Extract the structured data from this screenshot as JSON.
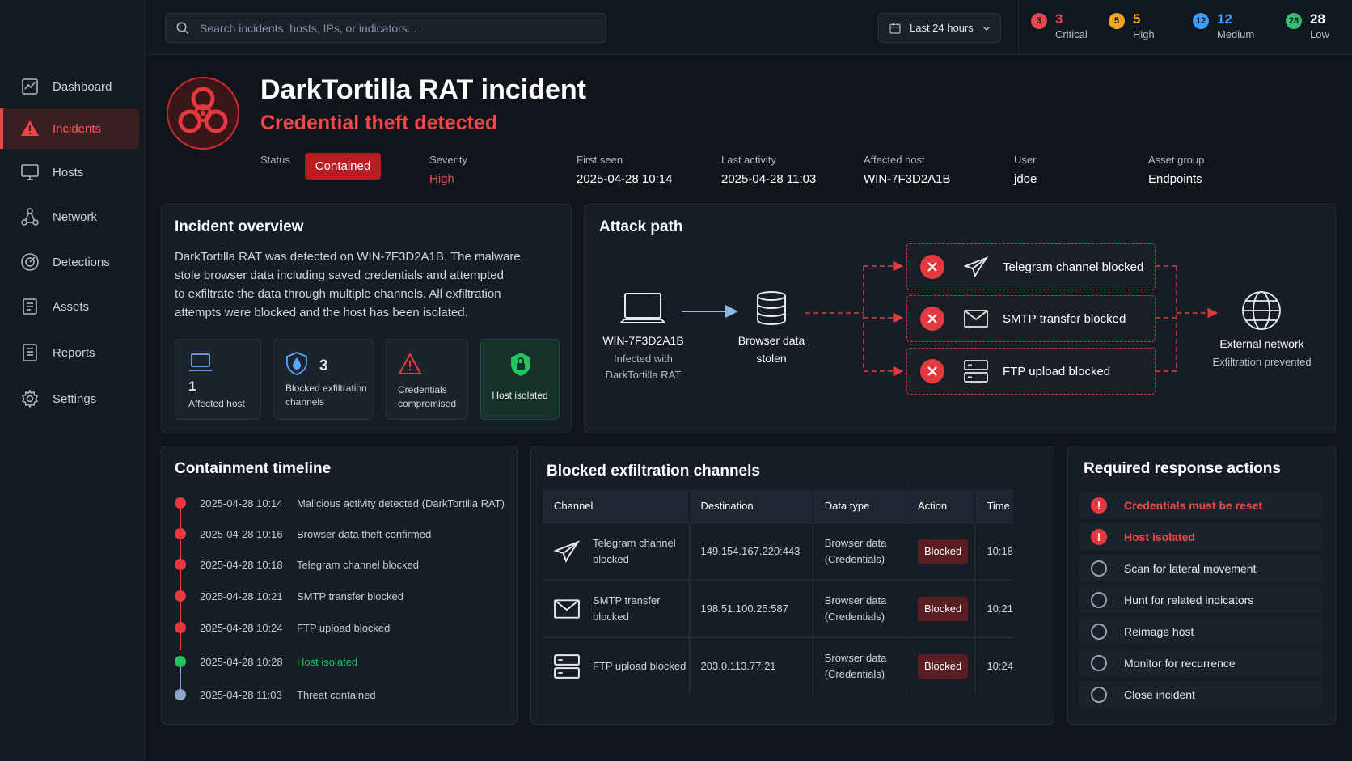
{
  "search": {
    "placeholder": "Search incidents, hosts, IPs, or indicators..."
  },
  "time_range": {
    "label": "Last 24 hours"
  },
  "severity_counts": [
    {
      "count": "3",
      "label": "Critical",
      "color": "#e5484d"
    },
    {
      "count": "5",
      "label": "High",
      "color": "#f5a524"
    },
    {
      "count": "12",
      "label": "Medium",
      "color": "#3b9eff"
    },
    {
      "count": "28",
      "label": "Low",
      "color": "#2fbf71"
    }
  ],
  "sidebar": {
    "items": [
      {
        "label": "Dashboard",
        "icon": "dashboard-icon"
      },
      {
        "label": "Incidents",
        "icon": "warning-icon"
      },
      {
        "label": "Hosts",
        "icon": "monitor-icon"
      },
      {
        "label": "Network",
        "icon": "network-icon"
      },
      {
        "label": "Detections",
        "icon": "radar-icon"
      },
      {
        "label": "Assets",
        "icon": "asset-icon"
      },
      {
        "label": "Reports",
        "icon": "report-icon"
      },
      {
        "label": "Settings",
        "icon": "gear-icon"
      }
    ]
  },
  "incident": {
    "title": "DarkTortilla RAT incident",
    "subtitle": "Credential theft detected",
    "status_label": "Status",
    "status_value": "Contained",
    "severity_label": "Severity",
    "severity_value": "High",
    "first_seen_label": "First seen",
    "first_seen_value": "2025-04-28 10:14",
    "last_activity_label": "Last activity",
    "last_activity_value": "2025-04-28 11:03",
    "affected_host_label": "Affected host",
    "affected_host_value": "WIN-7F3D2A1B",
    "user_label": "User",
    "user_value": "jdoe",
    "asset_group_label": "Asset group",
    "asset_group_value": "Endpoints"
  },
  "overview": {
    "title": "Incident overview",
    "lines": [
      "DarkTortilla RAT was detected on WIN-7F3D2A1B. The malware",
      "stole browser data including saved credentials and attempted",
      "to exfiltrate the data through multiple channels. All exfiltration",
      "attempts were blocked and the host has been isolated."
    ],
    "cards": [
      {
        "value": "1",
        "label": "Affected host",
        "icon": "laptop-icon"
      },
      {
        "value": "3",
        "label_line1": "Blocked exfiltration",
        "label_line2": "channels",
        "icon": "shield-drop-icon"
      },
      {
        "label_line1": "Credentials",
        "label_line2": "compromised",
        "icon": "alert-triangle-icon"
      },
      {
        "label": "Host isolated",
        "icon": "lock-shield-icon"
      }
    ]
  },
  "attack_path": {
    "title": "Attack path",
    "host_name": "WIN-7F3D2A1B",
    "host_sub1": "Infected with",
    "host_sub2": "DarkTortilla RAT",
    "data_label1": "Browser data",
    "data_label2": "stolen",
    "blocked": [
      {
        "label": "Telegram channel blocked",
        "icon": "paper-plane-icon"
      },
      {
        "label": "SMTP transfer blocked",
        "icon": "envelope-icon"
      },
      {
        "label": "FTP upload blocked",
        "icon": "server-icon"
      }
    ],
    "target_label": "External network",
    "target_sub": "Exfiltration prevented"
  },
  "timeline": {
    "title": "Containment timeline",
    "events": [
      {
        "time": "2025-04-28 10:14",
        "desc": "Malicious activity detected (DarkTortilla RAT)",
        "color": "#e53940"
      },
      {
        "time": "2025-04-28 10:16",
        "desc": "Browser data theft confirmed",
        "color": "#e53940"
      },
      {
        "time": "2025-04-28 10:18",
        "desc": "Telegram channel blocked",
        "color": "#e53940"
      },
      {
        "time": "2025-04-28 10:21",
        "desc": "SMTP transfer blocked",
        "color": "#e53940"
      },
      {
        "time": "2025-04-28 10:24",
        "desc": "FTP upload blocked",
        "color": "#e53940"
      },
      {
        "time": "2025-04-28 10:28",
        "desc": "Host isolated",
        "color": "#22c55e"
      },
      {
        "time": "2025-04-28 11:03",
        "desc": "Threat contained",
        "color": "#8fa3c4"
      }
    ]
  },
  "channels": {
    "title": "Blocked exfiltration channels",
    "headers": [
      "Channel",
      "Destination",
      "Data type",
      "Action",
      "Time"
    ],
    "rows": [
      {
        "channel1": "Telegram channel",
        "channel2": "blocked",
        "icon": "paper-plane-icon",
        "destination": "149.154.167.220:443",
        "type1": "Browser data",
        "type2": "(Credentials)",
        "action": "Blocked",
        "time": "10:18"
      },
      {
        "channel1": "SMTP transfer",
        "channel2": "blocked",
        "icon": "envelope-icon",
        "destination": "198.51.100.25:587",
        "type1": "Browser data",
        "type2": "(Credentials)",
        "action": "Blocked",
        "time": "10:21"
      },
      {
        "channel1": "FTP upload blocked",
        "channel2": "",
        "icon": "server-icon",
        "destination": "203.0.113.77:21",
        "type1": "Browser data",
        "type2": "(Credentials)",
        "action": "Blocked",
        "time": "10:24"
      }
    ]
  },
  "actions": {
    "title": "Required response actions",
    "items": [
      {
        "label": "Credentials must be reset",
        "urgent": true
      },
      {
        "label": "Host isolated",
        "urgent": true
      },
      {
        "label": "Scan for lateral movement",
        "urgent": false
      },
      {
        "label": "Hunt for related indicators",
        "urgent": false
      },
      {
        "label": "Reimage host",
        "urgent": false
      },
      {
        "label": "Monitor for recurrence",
        "urgent": false
      },
      {
        "label": "Close incident",
        "urgent": false
      }
    ]
  },
  "colors": {
    "accent_red": "#e53940",
    "success_green": "#22c55e",
    "background": "#10151c"
  }
}
